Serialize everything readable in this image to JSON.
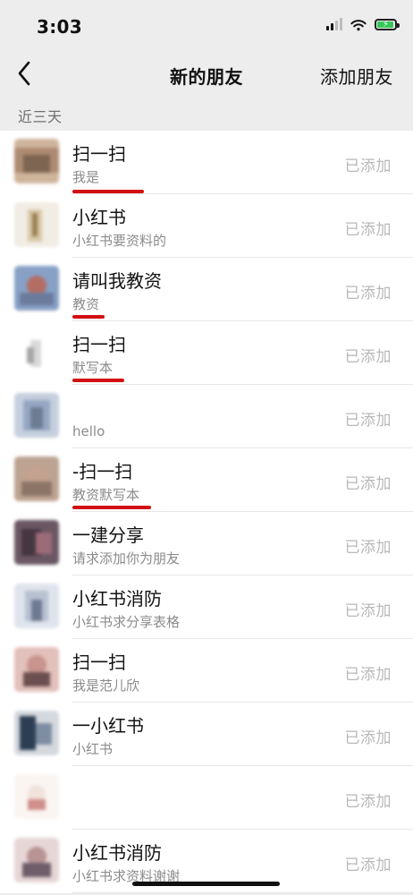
{
  "status_bar": {
    "time": "3:03"
  },
  "navigation": {
    "title": "新的朋友",
    "action_label": "添加朋友",
    "back_icon": "chevron-left-icon"
  },
  "section": {
    "label": "近三天"
  },
  "contacts": [
    {
      "name": "扫一扫",
      "message": "我是",
      "status": "已添加",
      "accent_colors": [
        "#ad8b72",
        "#7d6551"
      ]
    },
    {
      "name": "小红书",
      "message": "小红书要资料的",
      "status": "已添加",
      "accent_colors": [
        "#d8c8a6",
        "#9a7f57"
      ]
    },
    {
      "name": "请叫我教资",
      "message": "教资",
      "status": "已添加",
      "accent_colors": [
        "#6b7c9d",
        "#b46d63"
      ]
    },
    {
      "name": "扫一扫",
      "message": "默写本",
      "status": "已添加",
      "accent_colors": [
        "#d9d9d9",
        "#a6a6a6"
      ]
    },
    {
      "name": "",
      "message": "hello",
      "status": "已添加",
      "accent_colors": [
        "#95a7c3",
        "#6d7c93"
      ]
    },
    {
      "name": "-扫一扫",
      "message": "教资默写本",
      "status": "已添加",
      "accent_colors": [
        "#8c7567",
        "#c4a28f"
      ]
    },
    {
      "name": "一建分享",
      "message": "请求添加你为朋友",
      "status": "已添加",
      "accent_colors": [
        "#453641",
        "#9c6b78"
      ]
    },
    {
      "name": "小红书消防",
      "message": "小红书求分享表格",
      "status": "已添加",
      "accent_colors": [
        "#b8c1d2",
        "#6f7a92"
      ]
    },
    {
      "name": "扫一扫",
      "message": "我是范儿欣",
      "status": "已添加",
      "accent_colors": [
        "#c8948d",
        "#6c4f4f"
      ]
    },
    {
      "name": "一小红书",
      "message": "小红书",
      "status": "已添加",
      "accent_colors": [
        "#2d3e53",
        "#7f8da2"
      ]
    },
    {
      "name": "",
      "message": "",
      "status": "已添加",
      "accent_colors": [
        "#f1e3dc",
        "#d08f8b"
      ]
    },
    {
      "name": "小红书消防",
      "message": "小红书求资料谢谢",
      "status": "已添加",
      "accent_colors": [
        "#b99494",
        "#6f5e6a"
      ]
    }
  ]
}
